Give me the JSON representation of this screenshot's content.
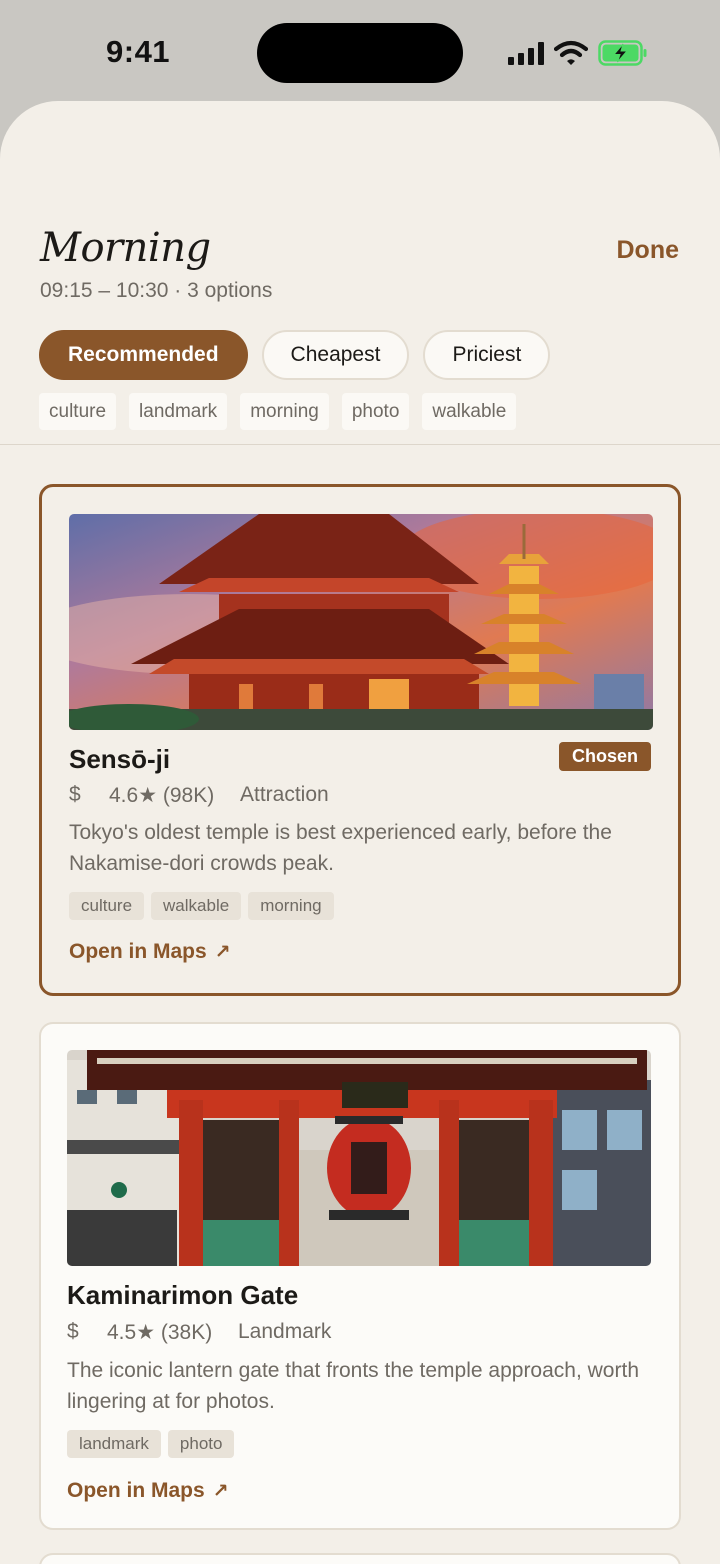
{
  "status_bar": {
    "time": "9:41"
  },
  "header": {
    "title": "Morning",
    "subtitle": "09:15 – 10:30 · 3 options",
    "done_label": "Done"
  },
  "sort_options": [
    {
      "label": "Recommended",
      "active": true
    },
    {
      "label": "Cheapest",
      "active": false
    },
    {
      "label": "Priciest",
      "active": false
    }
  ],
  "filters": [
    "culture",
    "landmark",
    "morning",
    "photo",
    "walkable"
  ],
  "cards": [
    {
      "name": "Sensō-ji",
      "badge": "Chosen",
      "price": "$",
      "rating": "4.6★ (98K)",
      "category": "Attraction",
      "description": "Tokyo's oldest temple is best experienced early, before the Nakamise-dori crowds peak.",
      "tags": [
        "culture",
        "walkable",
        "morning"
      ],
      "maps_label": "Open in Maps",
      "maps_icon": "arrow-up-right-icon",
      "image": "senso-ji-temple-photo"
    },
    {
      "name": "Kaminarimon Gate",
      "price": "$",
      "rating": "4.5★ (38K)",
      "category": "Landmark",
      "description": "The iconic lantern gate that fronts the temple approach, worth lingering at for photos.",
      "tags": [
        "landmark",
        "photo"
      ],
      "maps_label": "Open in Maps",
      "maps_icon": "arrow-up-right-icon",
      "image": "kaminarimon-gate-photo"
    }
  ],
  "colors": {
    "accent": "#8a562a",
    "sheet_background": "#f3efe8",
    "card_background": "#fcfbf8",
    "text_primary": "#1c1a17",
    "text_secondary": "#6f6a63",
    "battery": "#4cd964"
  }
}
